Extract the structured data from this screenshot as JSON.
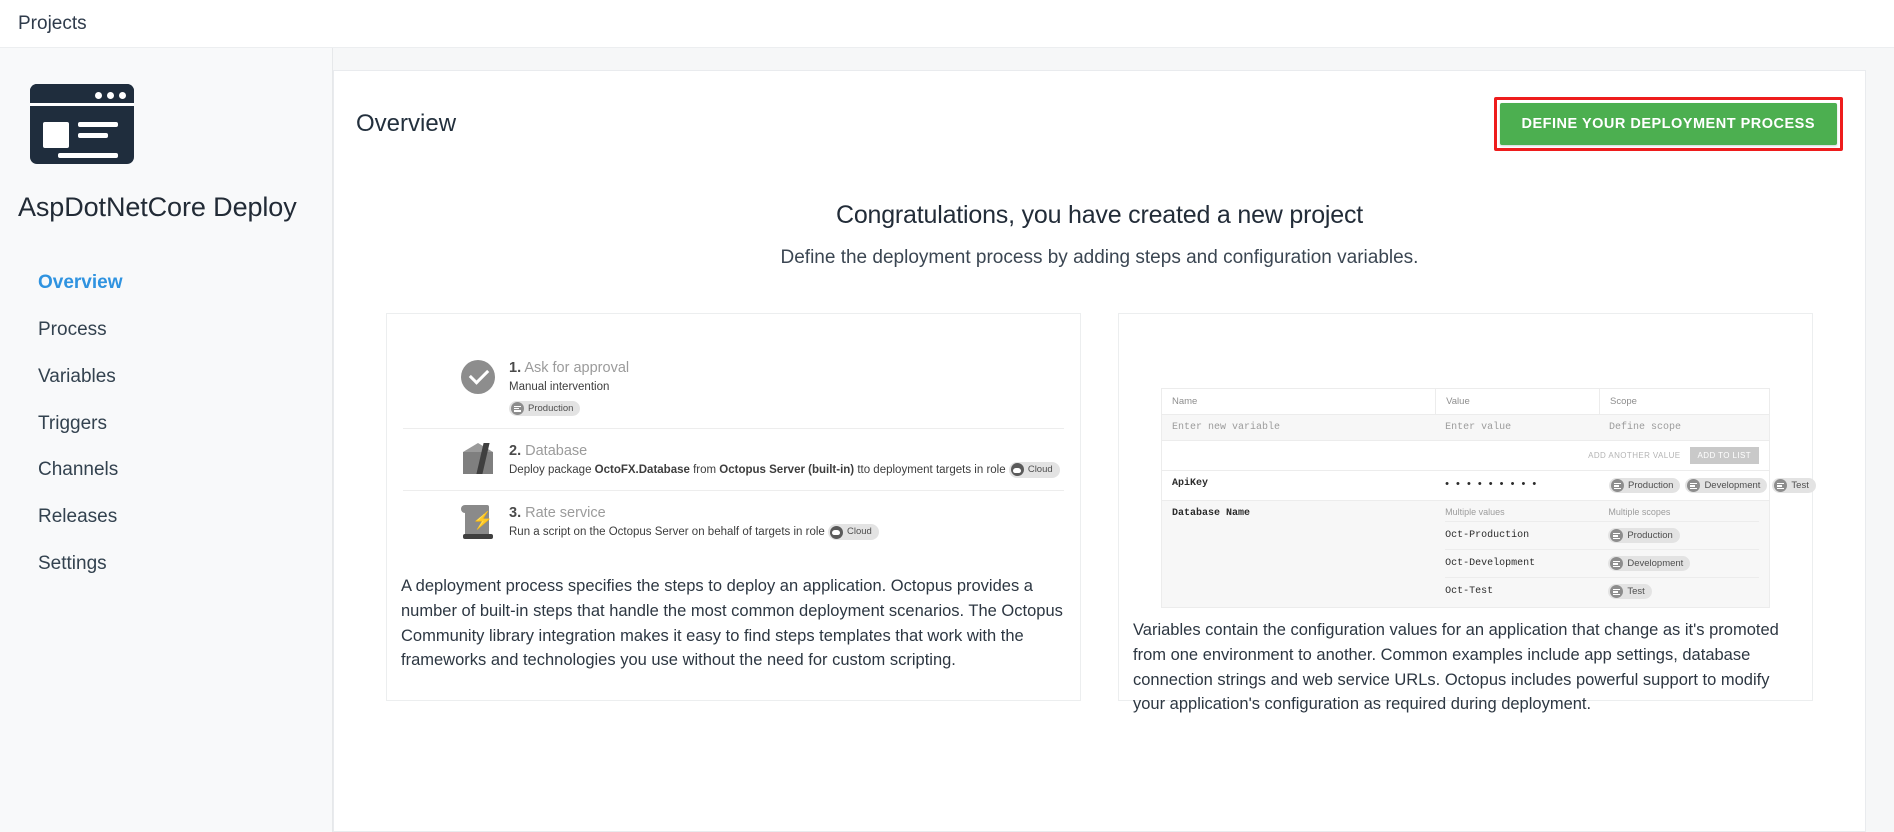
{
  "topbar": {
    "title": "Projects"
  },
  "sidebar": {
    "project_icon": "project-window-icon",
    "project_name": "AspDotNetCore Deploy",
    "items": [
      {
        "label": "Overview",
        "active": true
      },
      {
        "label": "Process",
        "active": false
      },
      {
        "label": "Variables",
        "active": false
      },
      {
        "label": "Triggers",
        "active": false
      },
      {
        "label": "Channels",
        "active": false
      },
      {
        "label": "Releases",
        "active": false
      },
      {
        "label": "Settings",
        "active": false
      }
    ]
  },
  "panel": {
    "title": "Overview",
    "cta_label": "DEFINE YOUR DEPLOYMENT PROCESS",
    "cta_color": "#4caf50",
    "highlight_color": "#ee1c1c"
  },
  "hero": {
    "heading": "Congratulations, you have created a new project",
    "subheading": "Define the deployment process by adding steps and configuration variables."
  },
  "cards": {
    "process": {
      "steps": [
        {
          "number": "1.",
          "name": "Ask for approval",
          "desc_prefix": "Manual intervention",
          "icon": "check-circle-icon",
          "tag": "Production",
          "tag_icon": "environment-icon"
        },
        {
          "number": "2.",
          "name": "Database",
          "desc_a": "Deploy package ",
          "desc_b": "OctoFX.Database",
          "desc_c": " from ",
          "desc_d": "Octopus Server (built-in)",
          "desc_e": " tto deployment targets in role ",
          "icon": "package-box-icon",
          "tag": "Cloud",
          "tag_icon": "role-tag-icon"
        },
        {
          "number": "3.",
          "name": "Rate service",
          "desc_a": "Run a script on the Octopus Server on behalf of targets in role ",
          "icon": "script-bolt-icon",
          "tag": "Cloud",
          "tag_icon": "role-tag-icon"
        }
      ],
      "description": "A deployment process specifies the steps to deploy an application. Octopus provides a number of built-in steps that handle the most common deployment scenarios. The Octopus Community library integration makes it easy to find steps templates that work with the frameworks and technologies you use without the need for custom scripting."
    },
    "variables": {
      "headers": {
        "name": "Name",
        "value": "Value",
        "scope": "Scope"
      },
      "placeholders": {
        "name": "Enter new variable",
        "value": "Enter value",
        "scope": "Define scope"
      },
      "actions": {
        "add_another": "ADD ANOTHER VALUE",
        "add_to_list": "ADD TO LIST"
      },
      "rows": [
        {
          "name": "ApiKey",
          "value": "• • • • • • • • •",
          "scopes": [
            "Production",
            "Development",
            "Test"
          ]
        }
      ],
      "multi_row": {
        "name": "Database Name",
        "values_header": "Multiple values",
        "scopes_header": "Multiple scopes",
        "entries": [
          {
            "value": "Oct-Production",
            "scope": "Production"
          },
          {
            "value": "Oct-Development",
            "scope": "Development"
          },
          {
            "value": "Oct-Test",
            "scope": "Test"
          }
        ]
      },
      "description": "Variables contain the configuration values for an application that change as it's promoted from one environment to another. Common examples include app settings, database connection strings and web service URLs. Octopus includes powerful support to modify your application's configuration as required during deployment."
    }
  }
}
